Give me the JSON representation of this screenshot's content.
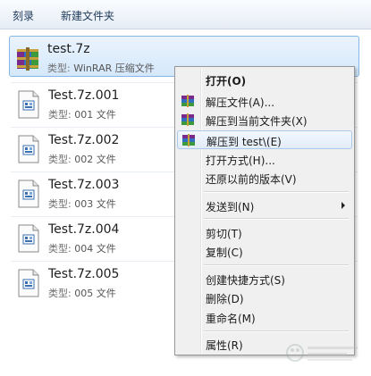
{
  "toolbar": {
    "burn_label": "刻录",
    "new_folder_label": "新建文件夹"
  },
  "files": [
    {
      "name": "test.7z",
      "type_label": "类型:",
      "type_value": "WinRAR 压缩文件",
      "icon": "winrar-archive-icon"
    },
    {
      "name": "Test.7z.001",
      "type_label": "类型:",
      "type_value": "001 文件",
      "icon": "generic-file-icon"
    },
    {
      "name": "Test.7z.002",
      "type_label": "类型:",
      "type_value": "002 文件",
      "icon": "generic-file-icon"
    },
    {
      "name": "Test.7z.003",
      "type_label": "类型:",
      "type_value": "003 文件",
      "icon": "generic-file-icon"
    },
    {
      "name": "Test.7z.004",
      "type_label": "类型:",
      "type_value": "004 文件",
      "icon": "generic-file-icon"
    },
    {
      "name": "Test.7z.005",
      "type_label": "类型:",
      "type_value": "005 文件",
      "icon": "generic-file-icon"
    }
  ],
  "context_menu": {
    "open": "打开(O)",
    "extract_files": "解压文件(A)...",
    "extract_here": "解压到当前文件夹(X)",
    "extract_to_folder": "解压到 test\\(E)",
    "open_with": "打开方式(H)...",
    "restore_previous": "还原以前的版本(V)",
    "send_to": "发送到(N)",
    "cut": "剪切(T)",
    "copy": "复制(C)",
    "create_shortcut": "创建快捷方式(S)",
    "delete": "删除(D)",
    "rename": "重命名(M)",
    "properties": "属性(R)"
  }
}
